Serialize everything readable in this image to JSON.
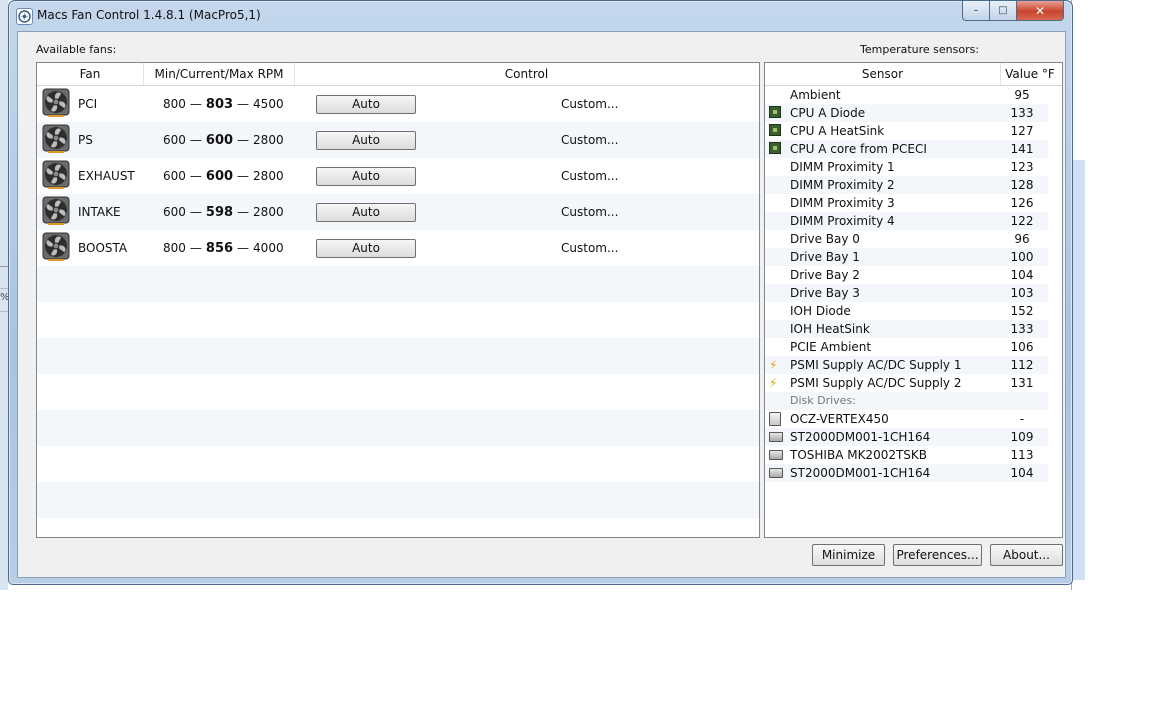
{
  "window": {
    "title": "Macs Fan Control 1.4.8.1 (MacPro5,1)",
    "controls": {
      "minimize": "–",
      "maximize": "□",
      "close": "✕"
    }
  },
  "fans_panel": {
    "label": "Available fans:",
    "columns": [
      "Fan",
      "Min/Current/Max RPM",
      "Control"
    ],
    "dash": "—",
    "rows": [
      {
        "name": "PCI",
        "min": "800",
        "current": "803",
        "max": "4500",
        "control": "Auto",
        "custom": "Custom..."
      },
      {
        "name": "PS",
        "min": "600",
        "current": "600",
        "max": "2800",
        "control": "Auto",
        "custom": "Custom..."
      },
      {
        "name": "EXHAUST",
        "min": "600",
        "current": "600",
        "max": "2800",
        "control": "Auto",
        "custom": "Custom..."
      },
      {
        "name": "INTAKE",
        "min": "600",
        "current": "598",
        "max": "2800",
        "control": "Auto",
        "custom": "Custom..."
      },
      {
        "name": "BOOSTA",
        "min": "800",
        "current": "856",
        "max": "4000",
        "control": "Auto",
        "custom": "Custom..."
      }
    ]
  },
  "sensors_panel": {
    "label": "Temperature sensors:",
    "columns": [
      "Sensor",
      "Value °F"
    ],
    "rows": [
      {
        "icon": "none",
        "name": "Ambient",
        "value": "95"
      },
      {
        "icon": "chip-icon",
        "name": "CPU A Diode",
        "value": "133"
      },
      {
        "icon": "chip-icon",
        "name": "CPU A HeatSink",
        "value": "127"
      },
      {
        "icon": "chip-icon",
        "name": "CPU A core from PCECI",
        "value": "141"
      },
      {
        "icon": "none",
        "name": "DIMM Proximity 1",
        "value": "123"
      },
      {
        "icon": "none",
        "name": "DIMM Proximity 2",
        "value": "128"
      },
      {
        "icon": "none",
        "name": "DIMM Proximity 3",
        "value": "126"
      },
      {
        "icon": "none",
        "name": "DIMM Proximity 4",
        "value": "122"
      },
      {
        "icon": "none",
        "name": "Drive Bay 0",
        "value": "96"
      },
      {
        "icon": "none",
        "name": "Drive Bay 1",
        "value": "100"
      },
      {
        "icon": "none",
        "name": "Drive Bay 2",
        "value": "104"
      },
      {
        "icon": "none",
        "name": "Drive Bay 3",
        "value": "103"
      },
      {
        "icon": "none",
        "name": "IOH Diode",
        "value": "152"
      },
      {
        "icon": "none",
        "name": "IOH HeatSink",
        "value": "133"
      },
      {
        "icon": "none",
        "name": "PCIE Ambient",
        "value": "106"
      },
      {
        "icon": "bolt-icon",
        "name": "PSMI Supply AC/DC Supply 1",
        "value": "112"
      },
      {
        "icon": "bolt-icon",
        "name": "PSMI Supply AC/DC Supply 2",
        "value": "131"
      },
      {
        "icon": "group",
        "name": "Disk Drives:",
        "value": ""
      },
      {
        "icon": "ssd-icon",
        "name": "OCZ-VERTEX450",
        "value": "-"
      },
      {
        "icon": "hdd-icon",
        "name": "ST2000DM001-1CH164",
        "value": "109"
      },
      {
        "icon": "hdd-icon",
        "name": "TOSHIBA MK2002TSKB",
        "value": "113"
      },
      {
        "icon": "hdd-icon",
        "name": "ST2000DM001-1CH164",
        "value": "104"
      }
    ]
  },
  "footer": {
    "minimize": "Minimize",
    "preferences": "Preferences...",
    "about": "About..."
  },
  "desktop": {
    "edge_mark": "%"
  }
}
